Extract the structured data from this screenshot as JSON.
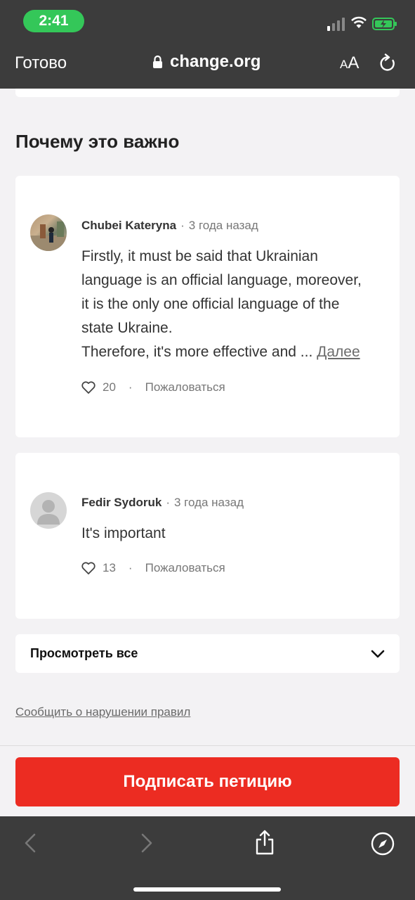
{
  "status_bar": {
    "time": "2:41"
  },
  "browser": {
    "done_label": "Готово",
    "url": "change.org",
    "text_size_small": "A",
    "text_size_large": "A"
  },
  "section": {
    "title": "Почему это важно"
  },
  "comments": [
    {
      "author": "Chubei Kateryna",
      "time_ago": "3 года назад",
      "text_lines": [
        "Firstly, it must be said that Ukrainian",
        "language is an official language, moreover,",
        "it is the only one official language of the",
        "state Ukraine.",
        "Therefore, it's more effective and ... "
      ],
      "more_label": "Далее",
      "likes": "20",
      "report_label": "Пожаловаться"
    },
    {
      "author": "Fedir Sydoruk",
      "time_ago": "3 года назад",
      "text": "It's important",
      "likes": "13",
      "report_label": "Пожаловаться"
    }
  ],
  "view_all_label": "Просмотреть все",
  "report_violation_label": "Сообщить о нарушении правил",
  "sign_button_label": "Подписать петицию",
  "colors": {
    "accent": "#ec2c22",
    "chrome": "#3c3c3c",
    "status_pill": "#34c759"
  },
  "icons": [
    "lock-icon",
    "reload-icon",
    "heart-icon",
    "chevron-down-icon",
    "back-icon",
    "forward-icon",
    "share-icon",
    "compass-icon"
  ]
}
